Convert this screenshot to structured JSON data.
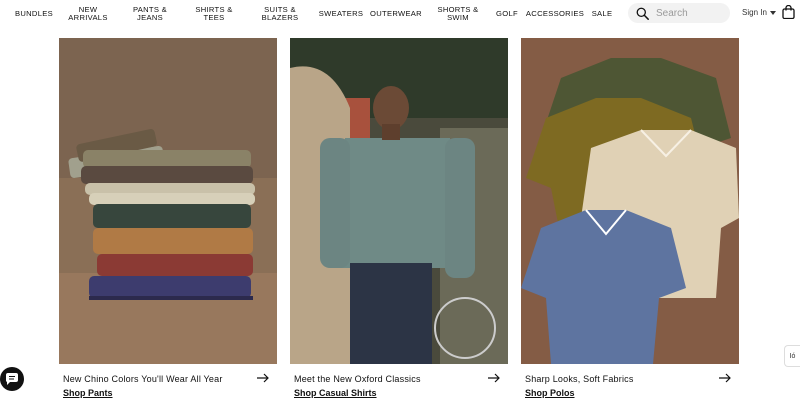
{
  "nav": {
    "items": [
      {
        "label": "BUNDLES"
      },
      {
        "label": "NEW ARRIVALS"
      },
      {
        "label": "PANTS & JEANS"
      },
      {
        "label": "SHIRTS & TEES"
      },
      {
        "label": "SUITS & BLAZERS"
      },
      {
        "label": "SWEATERS"
      },
      {
        "label": "OUTERWEAR"
      },
      {
        "label": "SHORTS & SWIM"
      },
      {
        "label": "GOLF"
      },
      {
        "label": "ACCESSORIES"
      },
      {
        "label": "SALE"
      }
    ],
    "search_placeholder": "Search",
    "sign_in": "Sign In"
  },
  "cards": [
    {
      "caption": "New Chino Colors You'll Wear All Year",
      "link": "Shop Pants"
    },
    {
      "caption": "Meet the New Oxford Classics",
      "link": "Shop Casual Shirts"
    },
    {
      "caption": "Sharp Looks, Soft Fabrics",
      "link": "Shop Polos"
    }
  ],
  "accessibility_label": "Ió",
  "colors": {
    "accent": "#111111",
    "search_bg": "#f2f2f2"
  }
}
